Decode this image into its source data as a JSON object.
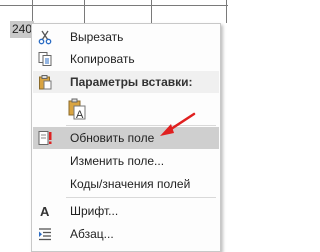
{
  "document": {
    "field_value": "240"
  },
  "context_menu": {
    "items": [
      {
        "label": "Вырезать",
        "icon": "scissors-icon"
      },
      {
        "label": "Копировать",
        "icon": "copy-icon"
      },
      {
        "label": "Параметры вставки:",
        "icon": "clipboard-icon"
      },
      {
        "label": "",
        "icon": "paste-keep-text-only-icon"
      },
      {
        "label": "Обновить поле",
        "icon": "update-field-icon",
        "highlighted": true
      },
      {
        "label": "Изменить поле...",
        "icon": ""
      },
      {
        "label": "Коды/значения полей",
        "icon": ""
      },
      {
        "label": "Шрифт...",
        "icon": "font-icon"
      },
      {
        "label": "Абзац...",
        "icon": "paragraph-icon"
      }
    ]
  },
  "annotation": {
    "arrow_color": "#e02020"
  }
}
